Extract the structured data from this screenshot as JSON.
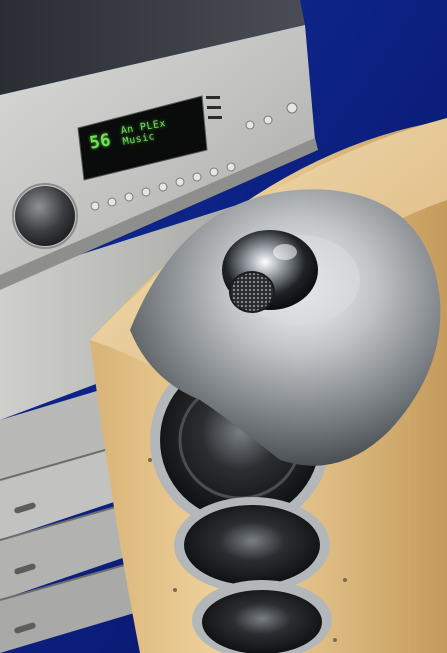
{
  "display": {
    "volume": "56",
    "mode_line1": "An PLEx",
    "mode_line2": "Music"
  },
  "icons": [
    "amplifier-image",
    "speaker-image",
    "tweeter-image",
    "volume-knob-icon"
  ],
  "colors": {
    "background_blue": "#0d1c73",
    "amp_silver": "#c9c9c9",
    "display_green": "#6fe25a",
    "maple_wood": "#e8c58a",
    "chrome_pod": "#bfc3c6"
  }
}
